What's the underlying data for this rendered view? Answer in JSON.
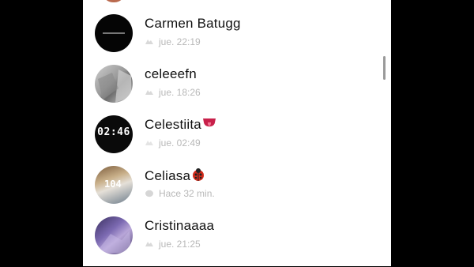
{
  "chats": [
    {
      "name": "Carmen Batugg",
      "time": "jue. 22:19",
      "status_icon": "opened-snap-icon",
      "name_emoji": "",
      "avatar": "black-logo"
    },
    {
      "name": "celeeefn",
      "time": "jue. 18:26",
      "status_icon": "opened-snap-icon",
      "name_emoji": "",
      "avatar": "grey-photo"
    },
    {
      "name": "Celestiita",
      "time": "jue. 02:49",
      "status_icon": "opened-snap-icon",
      "name_emoji": "tongue-emoji",
      "avatar": "clock-0246"
    },
    {
      "name": "Celiasa",
      "time": "Hace 32 min.",
      "status_icon": "unread-chat-icon",
      "name_emoji": "ladybug-emoji",
      "avatar": "selfie-104"
    },
    {
      "name": "Cristinaaaa",
      "time": "jue. 21:25",
      "status_icon": "opened-snap-icon",
      "name_emoji": "",
      "avatar": "purple-photo"
    }
  ],
  "avatar_texts": {
    "clock": "02:46",
    "selfie": "104"
  },
  "colors": {
    "background": "#000000",
    "list_bg": "#ffffff",
    "name": "#111111",
    "meta": "#b8b8b8",
    "scrollbar": "#9a9a9a"
  }
}
